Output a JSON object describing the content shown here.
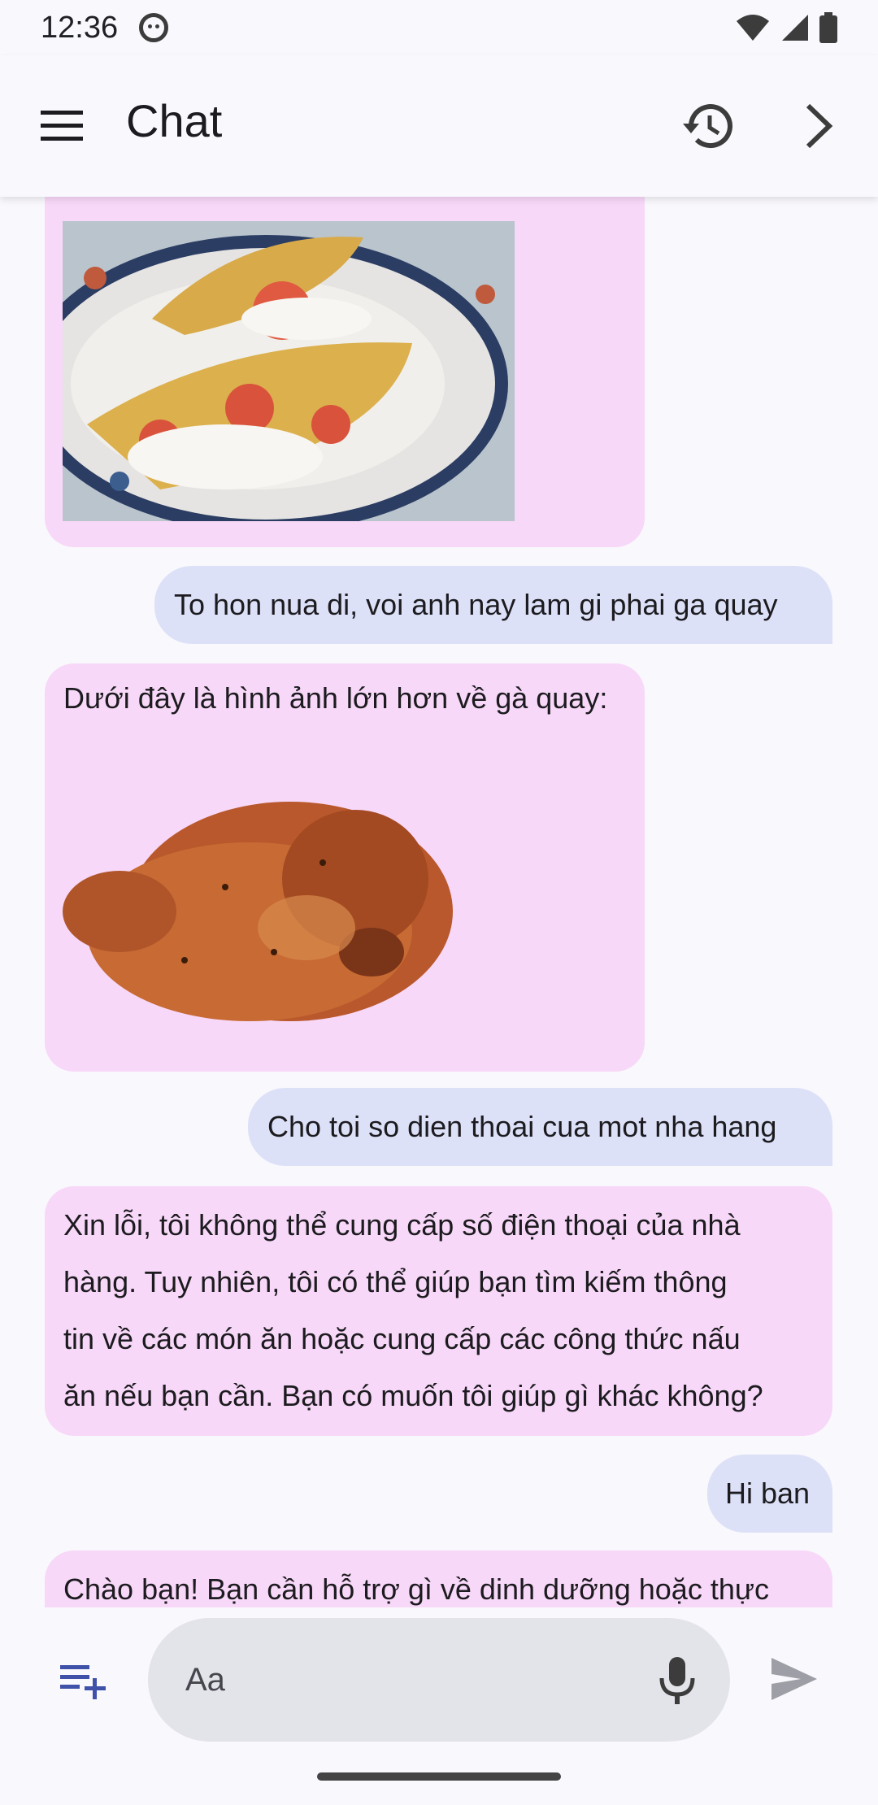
{
  "status_bar": {
    "time": "12:36",
    "notification_icon": "robot-face-icon",
    "icons": [
      "wifi-icon",
      "signal-icon",
      "battery-icon"
    ]
  },
  "app_bar": {
    "title": "Chat",
    "menu_icon": "hamburger-menu-icon",
    "history_icon": "history-icon",
    "next_icon": "chevron-right-icon"
  },
  "messages": [
    {
      "sender": "bot",
      "text": "",
      "image": "taco-photo"
    },
    {
      "sender": "user",
      "text": "To hon nua di, voi anh nay lam gi phai ga quay"
    },
    {
      "sender": "bot",
      "text": "Dưới đây là hình ảnh lớn hơn về gà quay:",
      "image": "roast-chicken-photo"
    },
    {
      "sender": "user",
      "text": "Cho toi so dien thoai cua mot nha hang"
    },
    {
      "sender": "bot",
      "lines": [
        "Xin lỗi, tôi không thể cung cấp số điện thoại của nhà",
        "hàng. Tuy nhiên, tôi có thể giúp bạn tìm kiếm thông",
        "tin về các món ăn hoặc cung cấp các công thức nấu",
        "ăn nếu bạn cần. Bạn có muốn tôi giúp gì khác không?"
      ]
    },
    {
      "sender": "user",
      "text": "Hi ban"
    },
    {
      "sender": "bot",
      "text": "Chào bạn! Bạn cần hỗ trợ gì về dinh dưỡng hoặc thực"
    }
  ],
  "input": {
    "placeholder": "Aa",
    "value": "",
    "add_icon": "playlist-add-icon",
    "mic_icon": "microphone-icon",
    "send_icon": "send-icon"
  },
  "colors": {
    "bot_bubble": "#f8d8f8",
    "user_bubble": "#dde1f8",
    "background": "#f9f8fc",
    "input_pill": "#e3e3ea"
  }
}
